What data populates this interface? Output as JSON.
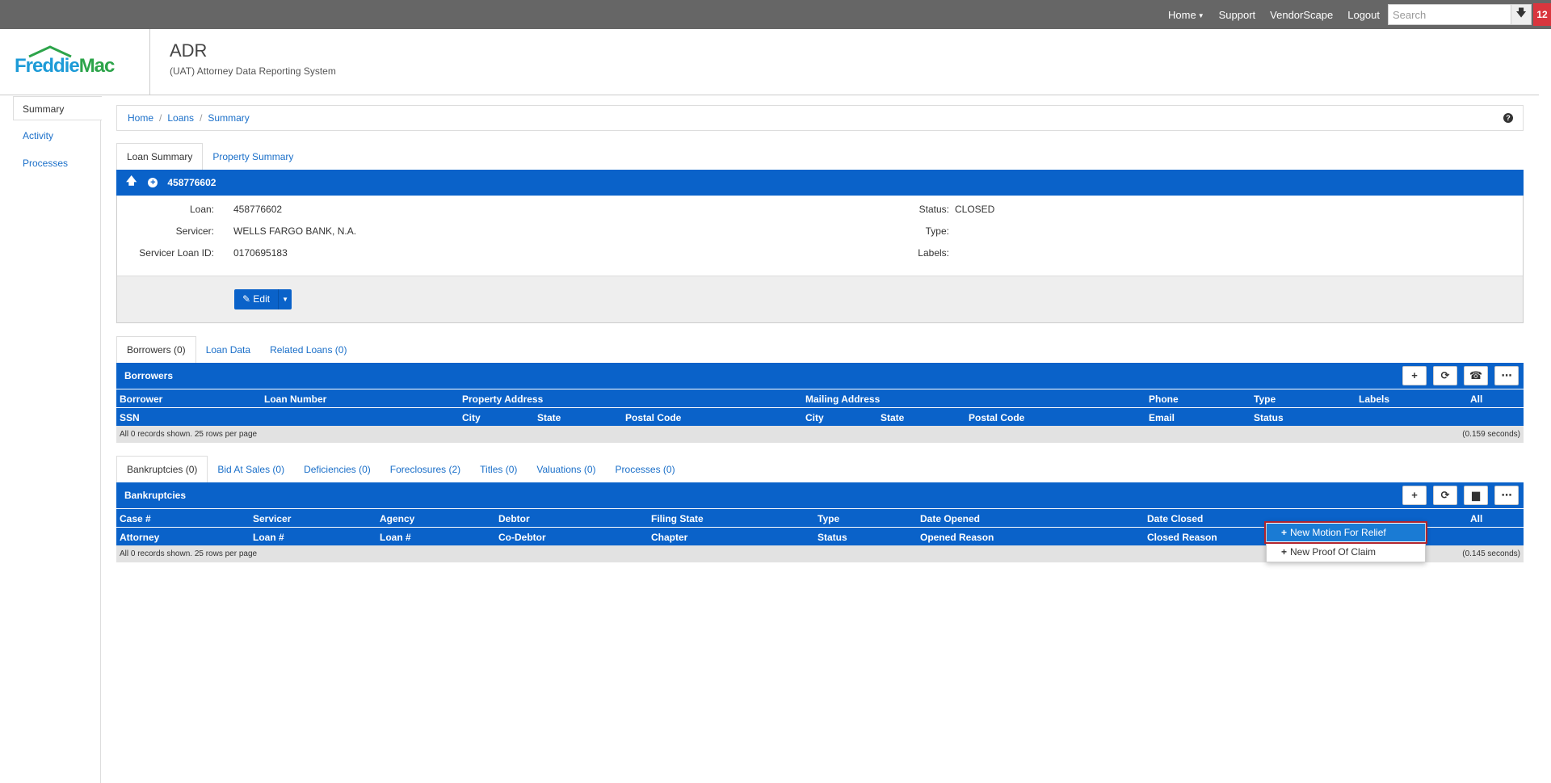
{
  "topnav": {
    "home": "Home",
    "support": "Support",
    "vendorscape": "VendorScape",
    "logout": "Logout",
    "search_placeholder": "Search",
    "notif_count": "12"
  },
  "header": {
    "logo_freddie": "Freddie",
    "logo_mac": "Mac",
    "title": "ADR",
    "subtitle": "(UAT) Attorney Data Reporting System"
  },
  "sidebar": {
    "items": [
      {
        "label": "Summary"
      },
      {
        "label": "Activity"
      },
      {
        "label": "Processes"
      }
    ]
  },
  "breadcrumb": [
    "Home",
    "Loans",
    "Summary"
  ],
  "loan_tabs": [
    "Loan Summary",
    "Property Summary"
  ],
  "loan": {
    "number": "458776602",
    "labels": {
      "loan": "Loan:",
      "servicer": "Servicer:",
      "servicer_loan_id": "Servicer Loan ID:",
      "status": "Status:",
      "type": "Type:",
      "labels": "Labels:"
    },
    "values": {
      "loan": "458776602",
      "servicer": "WELLS FARGO BANK, N.A.",
      "servicer_loan_id": "0170695183",
      "status": "CLOSED"
    },
    "edit_label": "Edit"
  },
  "borrower_tabs": [
    "Borrowers (0)",
    "Loan Data",
    "Related Loans (0)"
  ],
  "borrowers": {
    "title": "Borrowers",
    "cols1": [
      "Borrower",
      "Loan Number",
      "Property Address",
      "Mailing Address",
      "Phone",
      "Type",
      "Labels",
      "All"
    ],
    "cols2": [
      "SSN",
      "City",
      "State",
      "Postal Code",
      "City",
      "State",
      "Postal Code",
      "Email",
      "Status"
    ],
    "footer_left": "All 0 records shown. 25 rows per page",
    "footer_right": "(0.159 seconds)"
  },
  "case_tabs": [
    "Bankruptcies (0)",
    "Bid At Sales (0)",
    "Deficiencies (0)",
    "Foreclosures (2)",
    "Titles (0)",
    "Valuations (0)",
    "Processes (0)"
  ],
  "bankruptcies": {
    "title": "Bankruptcies",
    "cols1": [
      "Case #",
      "Servicer",
      "Agency",
      "Debtor",
      "Filing State",
      "Type",
      "Date Opened",
      "Date Closed",
      "All"
    ],
    "cols2": [
      "Attorney",
      "Loan #",
      "Loan #",
      "Co-Debtor",
      "Chapter",
      "Status",
      "Opened Reason",
      "Closed Reason"
    ],
    "footer_left": "All 0 records shown. 25 rows per page",
    "footer_right": "(0.145 seconds)"
  },
  "dropdown": {
    "items": [
      "New Motion For Relief",
      "New Proof Of Claim"
    ]
  },
  "colors": {
    "topbar": "#666666",
    "primary": "#0a62c9",
    "link": "#1a6fc9",
    "badge": "#d9363e",
    "highlight_border": "#b0252e"
  }
}
